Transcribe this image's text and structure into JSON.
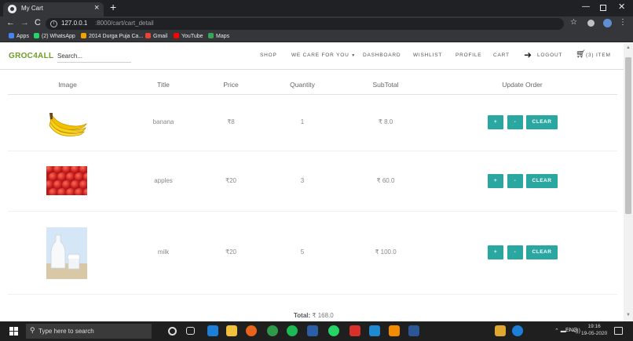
{
  "browser": {
    "tab_title": "My Cart",
    "url_host": "127.0.0.1",
    "url_path": ":8000/cart/cart_detail",
    "bookmarks": [
      {
        "label": "Apps",
        "color": "#4285f4"
      },
      {
        "label": "(2) WhatsApp",
        "color": "#25d366"
      },
      {
        "label": "2014 Durga Puja Ca...",
        "color": "#f4a100"
      },
      {
        "label": "Gmail",
        "color": "#ea4335"
      },
      {
        "label": "YouTube",
        "color": "#ff0000"
      },
      {
        "label": "Maps",
        "color": "#34a853"
      }
    ]
  },
  "navbar": {
    "brand": "GROC4ALL",
    "search_placeholder": "Search...",
    "links": {
      "shop": "SHOP",
      "we_care": "WE CARE FOR YOU",
      "dashboard": "DASHBOARD",
      "wishlist": "WISHLIST",
      "profile": "PROFILE",
      "cart": "CART",
      "logout": "LOGOUT",
      "cart_count": "(3) ITEM"
    },
    "brand_color": "#6e9e27"
  },
  "table": {
    "headers": {
      "image": "Image",
      "title": "Title",
      "price": "Price",
      "quantity": "Quantity",
      "subtotal": "SubTotal",
      "update": "Update Order"
    },
    "rows": [
      {
        "image_icon": "banana-image",
        "title": "banana",
        "price": "₹8",
        "quantity": "1",
        "subtotal": "₹ 8.0"
      },
      {
        "image_icon": "apples-image",
        "title": "apples",
        "price": "₹20",
        "quantity": "3",
        "subtotal": "₹ 60.0"
      },
      {
        "image_icon": "milk-image",
        "title": "milk",
        "price": "₹20",
        "quantity": "5",
        "subtotal": "₹ 100.0"
      }
    ],
    "buttons": {
      "plus": "+",
      "minus": "-",
      "clear": "CLEAR"
    },
    "button_color": "#2aa7a0"
  },
  "summary": {
    "total_label": "Total:",
    "total_value": "₹ 168.0"
  },
  "taskbar": {
    "search_placeholder": "Type here to search",
    "language": "ENG",
    "time": "19:16",
    "date": "19-05-2020"
  }
}
